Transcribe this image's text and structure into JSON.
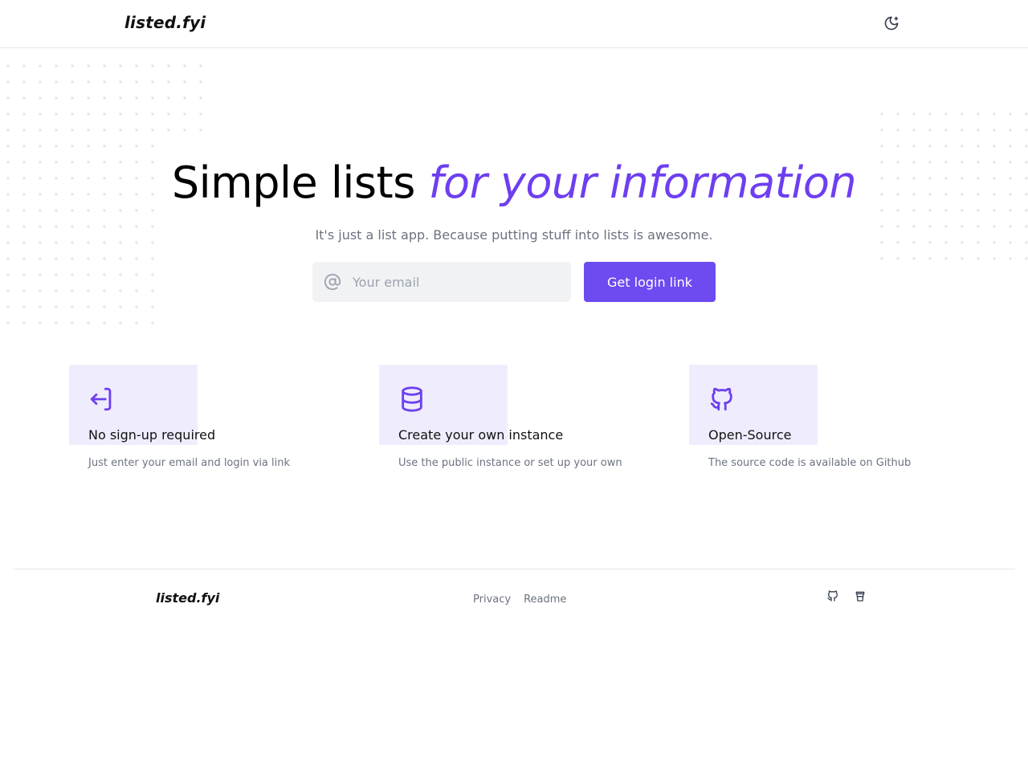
{
  "header": {
    "logo": "listed.fyi",
    "theme_toggle_icon": "moon-icon"
  },
  "hero": {
    "title_plain": "Simple lists",
    "title_accent": "for your information",
    "subtitle": "It's just a list app. Because putting stuff into lists is awesome.",
    "email_placeholder": "Your email",
    "email_value": "",
    "button_label": "Get login link"
  },
  "features": [
    {
      "icon": "login-icon",
      "title": "No sign-up required",
      "description": "Just enter your email and login via link"
    },
    {
      "icon": "database-icon",
      "title": "Create your own instance",
      "description": "Use the public instance or set up your own"
    },
    {
      "icon": "github-icon",
      "title": "Open-Source",
      "description": "The source code is available on Github"
    }
  ],
  "footer": {
    "logo": "listed.fyi",
    "links": [
      "Privacy",
      "Readme"
    ],
    "icons": [
      "github-icon",
      "coffee-cup-icon"
    ]
  },
  "colors": {
    "accent": "#6d3ff0",
    "button": "#6d4bf0",
    "icon_bg": "#efedfd"
  }
}
